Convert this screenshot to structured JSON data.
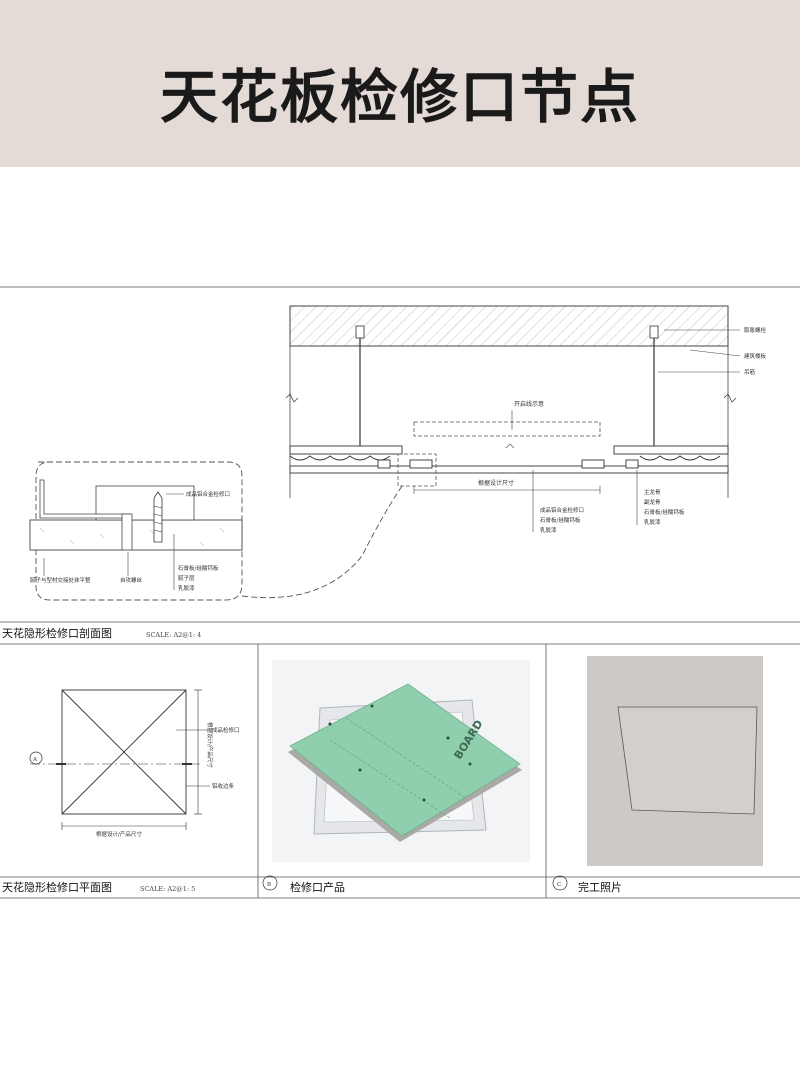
{
  "header": {
    "title": "天花板检修口节点"
  },
  "section_drawing": {
    "caption": "天花隐形检修口剖面图",
    "scale": "SCALE: A2@1: 4",
    "callouts_right": [
      "膨胀螺栓",
      "建筑楼板",
      "吊筋",
      "主龙骨",
      "副龙骨",
      "石膏板/硅酸钙板",
      "乳胶漆"
    ],
    "callouts_center": [
      "成品铝合金检修口",
      "石膏板/硅酸钙板",
      "乳胶漆"
    ],
    "opening_label": "开启线示意",
    "dimension_label": "根据设计尺寸",
    "detail_callouts": [
      "成品铝合金检修口",
      "石膏板/硅酸钙板",
      "腻子层",
      "乳胶漆"
    ],
    "detail_left_note": "腻子与型材交接处抹平整",
    "detail_screw": "自攻螺丝"
  },
  "plan_drawing": {
    "caption": "天花隐形检修口平面图",
    "scale": "SCALE: A2@1: 5",
    "marker": "A",
    "label_product": "成品检修口",
    "label_edge": "铝收边条",
    "dim_bottom": "根据设计/产品尺寸",
    "dim_right": "根据设计/产品尺寸"
  },
  "product_panel": {
    "marker": "B",
    "caption": "检修口产品",
    "board_print": "BOARD"
  },
  "photo_panel": {
    "marker": "C",
    "caption": "完工照片"
  },
  "colors": {
    "header_bg": "#e4dbd6",
    "board_green": "#8fcfae",
    "frame_silver": "#d9dbde",
    "wall_gray": "#cdcac6"
  }
}
